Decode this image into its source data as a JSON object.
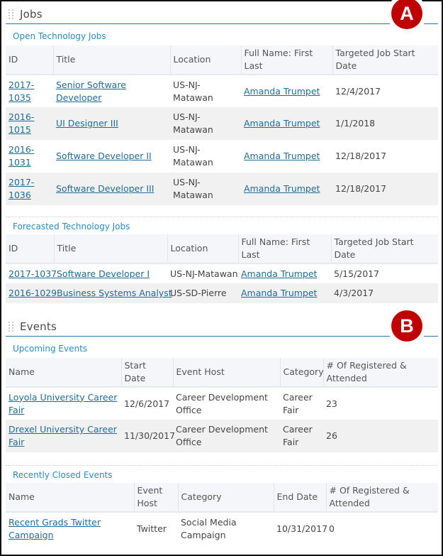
{
  "jobs_panel": {
    "title": "Jobs",
    "marker": "A",
    "open": {
      "title": "Open Technology Jobs",
      "columns": [
        "ID",
        "Title",
        "Location",
        "Full Name: First Last",
        "Targeted Job Start Date"
      ],
      "rows": [
        {
          "id": "2017-1035",
          "title": "Senior Software Developer",
          "location": "US-NJ-Matawan",
          "name": "Amanda Trumpet",
          "date": "12/4/2017"
        },
        {
          "id": "2016-1015",
          "title": "UI Designer III",
          "location": "US-NJ-Matawan",
          "name": "Amanda Trumpet",
          "date": "1/1/2018"
        },
        {
          "id": "2016-1031",
          "title": "Software Developer II",
          "location": "US-NJ-Matawan",
          "name": "Amanda Trumpet",
          "date": "12/18/2017"
        },
        {
          "id": "2017-1036",
          "title": "Software Developer III",
          "location": "US-NJ-Matawan",
          "name": "Amanda Trumpet",
          "date": "12/18/2017"
        }
      ]
    },
    "forecasted": {
      "title": "Forecasted Technology Jobs",
      "columns": [
        "ID",
        "Title",
        "Location",
        "Full Name: First Last",
        "Targeted Job Start Date"
      ],
      "rows": [
        {
          "id": "2017-1037",
          "title": "Software Developer I",
          "location": "US-NJ-Matawan",
          "name": "Amanda Trumpet",
          "date": "5/15/2017"
        },
        {
          "id": "2016-1029",
          "title": "Business Systems Analyst",
          "location": "US-SD-Pierre",
          "name": "Amanda Trumpet",
          "date": "4/3/2017"
        }
      ]
    }
  },
  "events_panel": {
    "title": "Events",
    "marker": "B",
    "upcoming": {
      "title": "Upcoming Events",
      "columns": [
        "Name",
        "Start Date",
        "Event Host",
        "Category",
        "# Of Registered & Attended"
      ],
      "rows": [
        {
          "name": "Loyola University Career Fair",
          "start": "12/6/2017",
          "host": "Career Development Office",
          "category": "Career Fair",
          "count": "23"
        },
        {
          "name": "Drexel University Career Fair",
          "start": "11/30/2017",
          "host": "Career Development Office",
          "category": "Career Fair",
          "count": "26"
        }
      ]
    },
    "closed": {
      "title": "Recently Closed Events",
      "columns": [
        "Name",
        "Event Host",
        "Category",
        "End Date",
        "# Of Registered & Attended"
      ],
      "rows": [
        {
          "name": "Recent Grads Twitter Campaign",
          "host": "Twitter",
          "category": "Social Media Campaign",
          "end": "10/31/2017",
          "count": "0"
        }
      ]
    }
  }
}
